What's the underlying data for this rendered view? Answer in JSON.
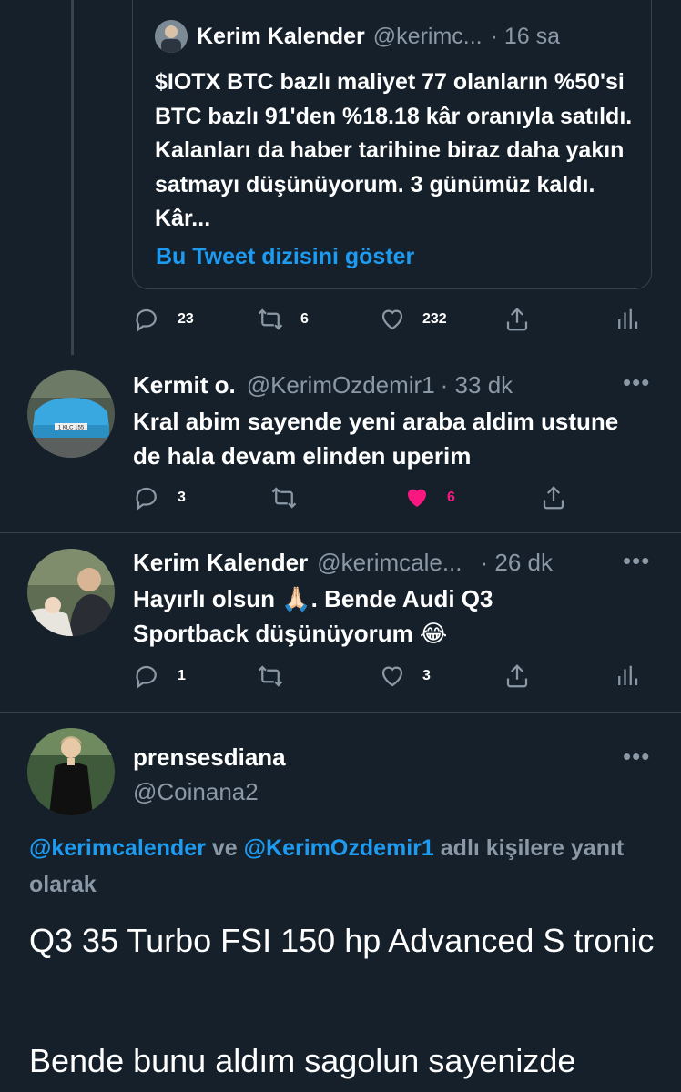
{
  "quoted_tweet": {
    "name": "Kerim Kalender",
    "handle": "@kerimc...",
    "time": "· 16 sa",
    "text": "$IOTX BTC bazlı maliyet 77 olanların %50'si BTC bazlı 91'den %18.18 kâr oranıyla satıldı. Kalanları da haber tarihine biraz daha yakın satmayı düşünüyorum. 3 günümüz kaldı. Kâr...",
    "show_thread": "Bu Tweet dizisini göster"
  },
  "parent_actions": {
    "replies": "23",
    "retweets": "6",
    "likes": "232"
  },
  "reply1": {
    "name": "Kermit o.",
    "handle": "@KerimOzdemir1",
    "time": "· 33 dk",
    "text": "Kral abim sayende yeni araba aldim ustune de hala devam elinden uperim",
    "replies": "3",
    "likes": "6",
    "plate": "1 KLC 155"
  },
  "reply2": {
    "name": "Kerim Kalender",
    "handle": "@kerimcale...",
    "time": "· 26 dk",
    "text": "Hayırlı olsun 🙏🏻. Bende Audi Q3 Sportback düşünüyorum 😂",
    "replies": "1",
    "likes": "3"
  },
  "main_tweet": {
    "name": "prensesdiana",
    "handle": "@Coinana2",
    "reply_to_user1": "@kerimcalender",
    "reply_to_and": "ve",
    "reply_to_user2": "@KerimOzdemir1",
    "reply_to_suffix": "adlı kişilere yanıt olarak",
    "line1": "Q3 35 Turbo FSI 150 hp Advanced S tronic",
    "line2": "Bende bunu aldım sagolun sayenizde"
  },
  "colors": {
    "background": "#15202b",
    "accent": "#1d9bf0",
    "muted": "#8b98a5",
    "like_active": "#f91880",
    "border": "#38444d"
  },
  "icons": [
    "reply-icon",
    "retweet-icon",
    "like-icon",
    "share-icon",
    "analytics-icon",
    "more-icon"
  ]
}
